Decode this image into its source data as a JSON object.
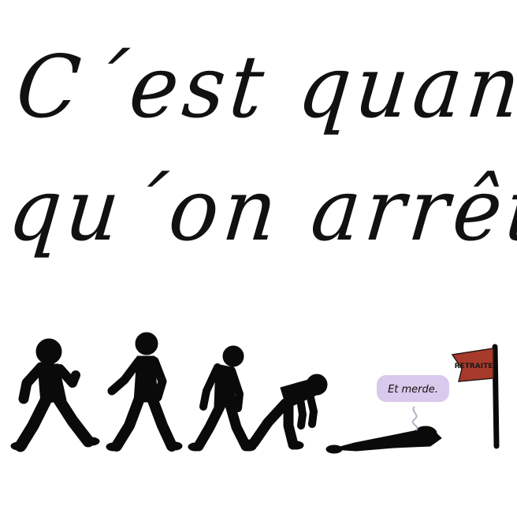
{
  "headline": {
    "line1": "C´est quand",
    "line2": "qu´on arrête ?"
  },
  "speech_bubble": {
    "text": "Et merde.",
    "color": "#d9c9ec"
  },
  "flag": {
    "label": "RETRAITE",
    "color": "#a83a2b"
  },
  "figures": [
    {
      "pose": "running"
    },
    {
      "pose": "walking"
    },
    {
      "pose": "tired-walking"
    },
    {
      "pose": "bent-over"
    },
    {
      "pose": "lying-down"
    }
  ]
}
